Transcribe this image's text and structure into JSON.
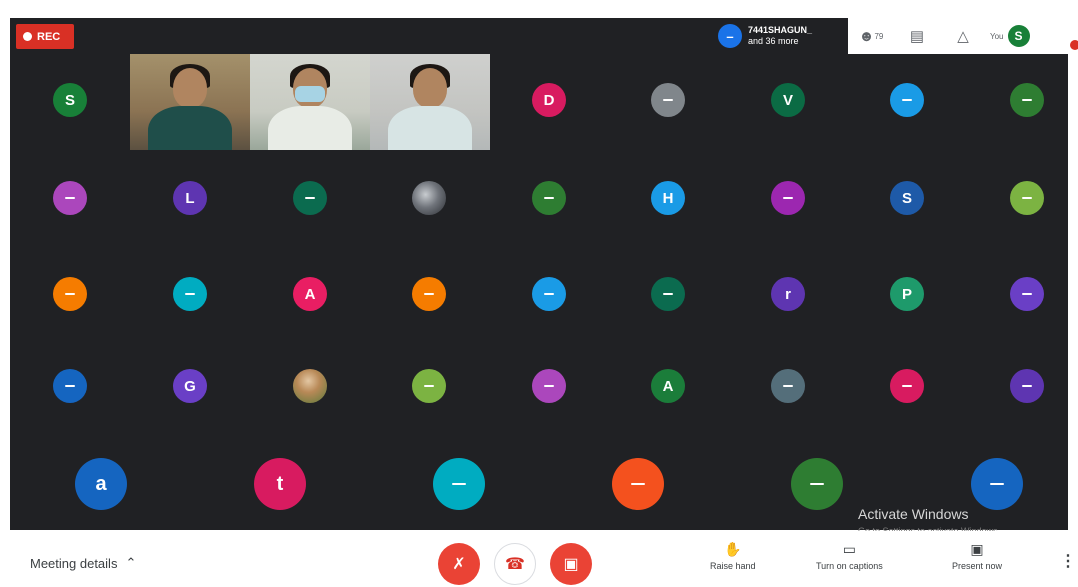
{
  "rec_label": "REC",
  "presence": {
    "avatar_letter": "–",
    "name": "7441SHAGUN_",
    "more": "and 36 more"
  },
  "topbar": {
    "people_count": "79",
    "you_label": "You",
    "you_letter": "S"
  },
  "watermark": {
    "line1": "Activate Windows",
    "line2": "Go to Settings to activate Windows."
  },
  "bottombar": {
    "meeting_details": "Meeting details",
    "raise_hand": "Raise hand",
    "captions": "Turn on captions",
    "present": "Present now"
  },
  "tiles": [
    {
      "label": "S",
      "color": "#188038"
    },
    {
      "label": "D",
      "color": "#d81b60"
    },
    {
      "label": "",
      "color": "#80868b"
    },
    {
      "label": "V",
      "color": "#0b6b44"
    },
    {
      "label": "",
      "color": "#1a9be6"
    },
    {
      "label": "",
      "color": "#2e7d32"
    },
    {
      "label": "",
      "color": "#ab47bc"
    },
    {
      "label": "L",
      "color": "#5e35b1"
    },
    {
      "label": "",
      "color": "#0b6b4f"
    },
    {
      "label": "",
      "color": "photo-a"
    },
    {
      "label": "",
      "color": "#2e7d32"
    },
    {
      "label": "H",
      "color": "#1a9be6"
    },
    {
      "label": "",
      "color": "#9c27b0"
    },
    {
      "label": "S",
      "color": "#1e5aa8"
    },
    {
      "label": "",
      "color": "#7cb342"
    },
    {
      "label": "",
      "color": "#f57c00"
    },
    {
      "label": "",
      "color": "#00acc1"
    },
    {
      "label": "A",
      "color": "#e91e63"
    },
    {
      "label": "",
      "color": "#f57c00"
    },
    {
      "label": "",
      "color": "#1a9be6"
    },
    {
      "label": "",
      "color": "#0b6b4f"
    },
    {
      "label": "r",
      "color": "#5e35b1"
    },
    {
      "label": "P",
      "color": "#1e9a6b"
    },
    {
      "label": "",
      "color": "#6a3fc6"
    },
    {
      "label": "",
      "color": "#1565c0"
    },
    {
      "label": "G",
      "color": "#6a3fc6"
    },
    {
      "label": "",
      "color": "photo-b"
    },
    {
      "label": "",
      "color": "#7cb342"
    },
    {
      "label": "",
      "color": "#ab47bc"
    },
    {
      "label": "A",
      "color": "#1b7d3a"
    },
    {
      "label": "",
      "color": "#546e7a"
    },
    {
      "label": "",
      "color": "#d81b60"
    },
    {
      "label": "",
      "color": "#5e35b1"
    },
    {
      "label": "a",
      "color": "#1565c0"
    },
    {
      "label": "t",
      "color": "#d81b60"
    },
    {
      "label": "",
      "color": "#00acc1"
    },
    {
      "label": "",
      "color": "#f4511e"
    },
    {
      "label": "",
      "color": "#2e7d32"
    },
    {
      "label": "",
      "color": "#1565c0"
    }
  ]
}
